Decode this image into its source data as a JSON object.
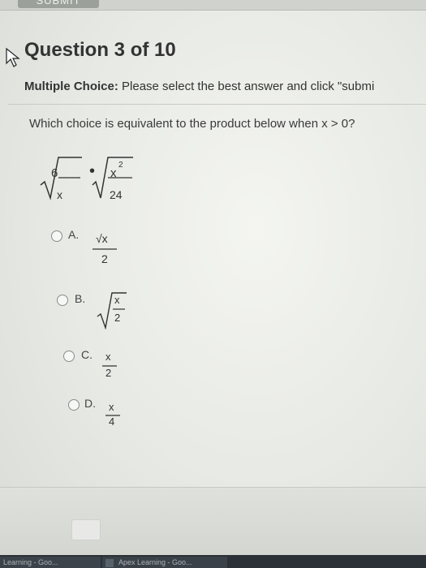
{
  "window": {
    "submit_label": "SUBMIT"
  },
  "header": {
    "title": "Question 3 of 10"
  },
  "instructions": {
    "label": "Multiple Choice:",
    "text": "Please select the best answer and click \"submi"
  },
  "question": {
    "text": "Which choice is equivalent to the product below when x > 0?",
    "expr": {
      "left_num": "6",
      "left_den": "x",
      "dot": "•",
      "right_num": "x",
      "right_exp": "2",
      "right_den": "24"
    }
  },
  "options": [
    {
      "letter": "A.",
      "num": "√x",
      "den": "2"
    },
    {
      "letter": "B.",
      "num": "x",
      "den": "2"
    },
    {
      "letter": "C.",
      "num": "x",
      "den": "2"
    },
    {
      "letter": "D.",
      "num": "x",
      "den": "4"
    }
  ],
  "taskbar": {
    "items": [
      "Learning - Goo...",
      "Apex Learning - Goo..."
    ]
  }
}
